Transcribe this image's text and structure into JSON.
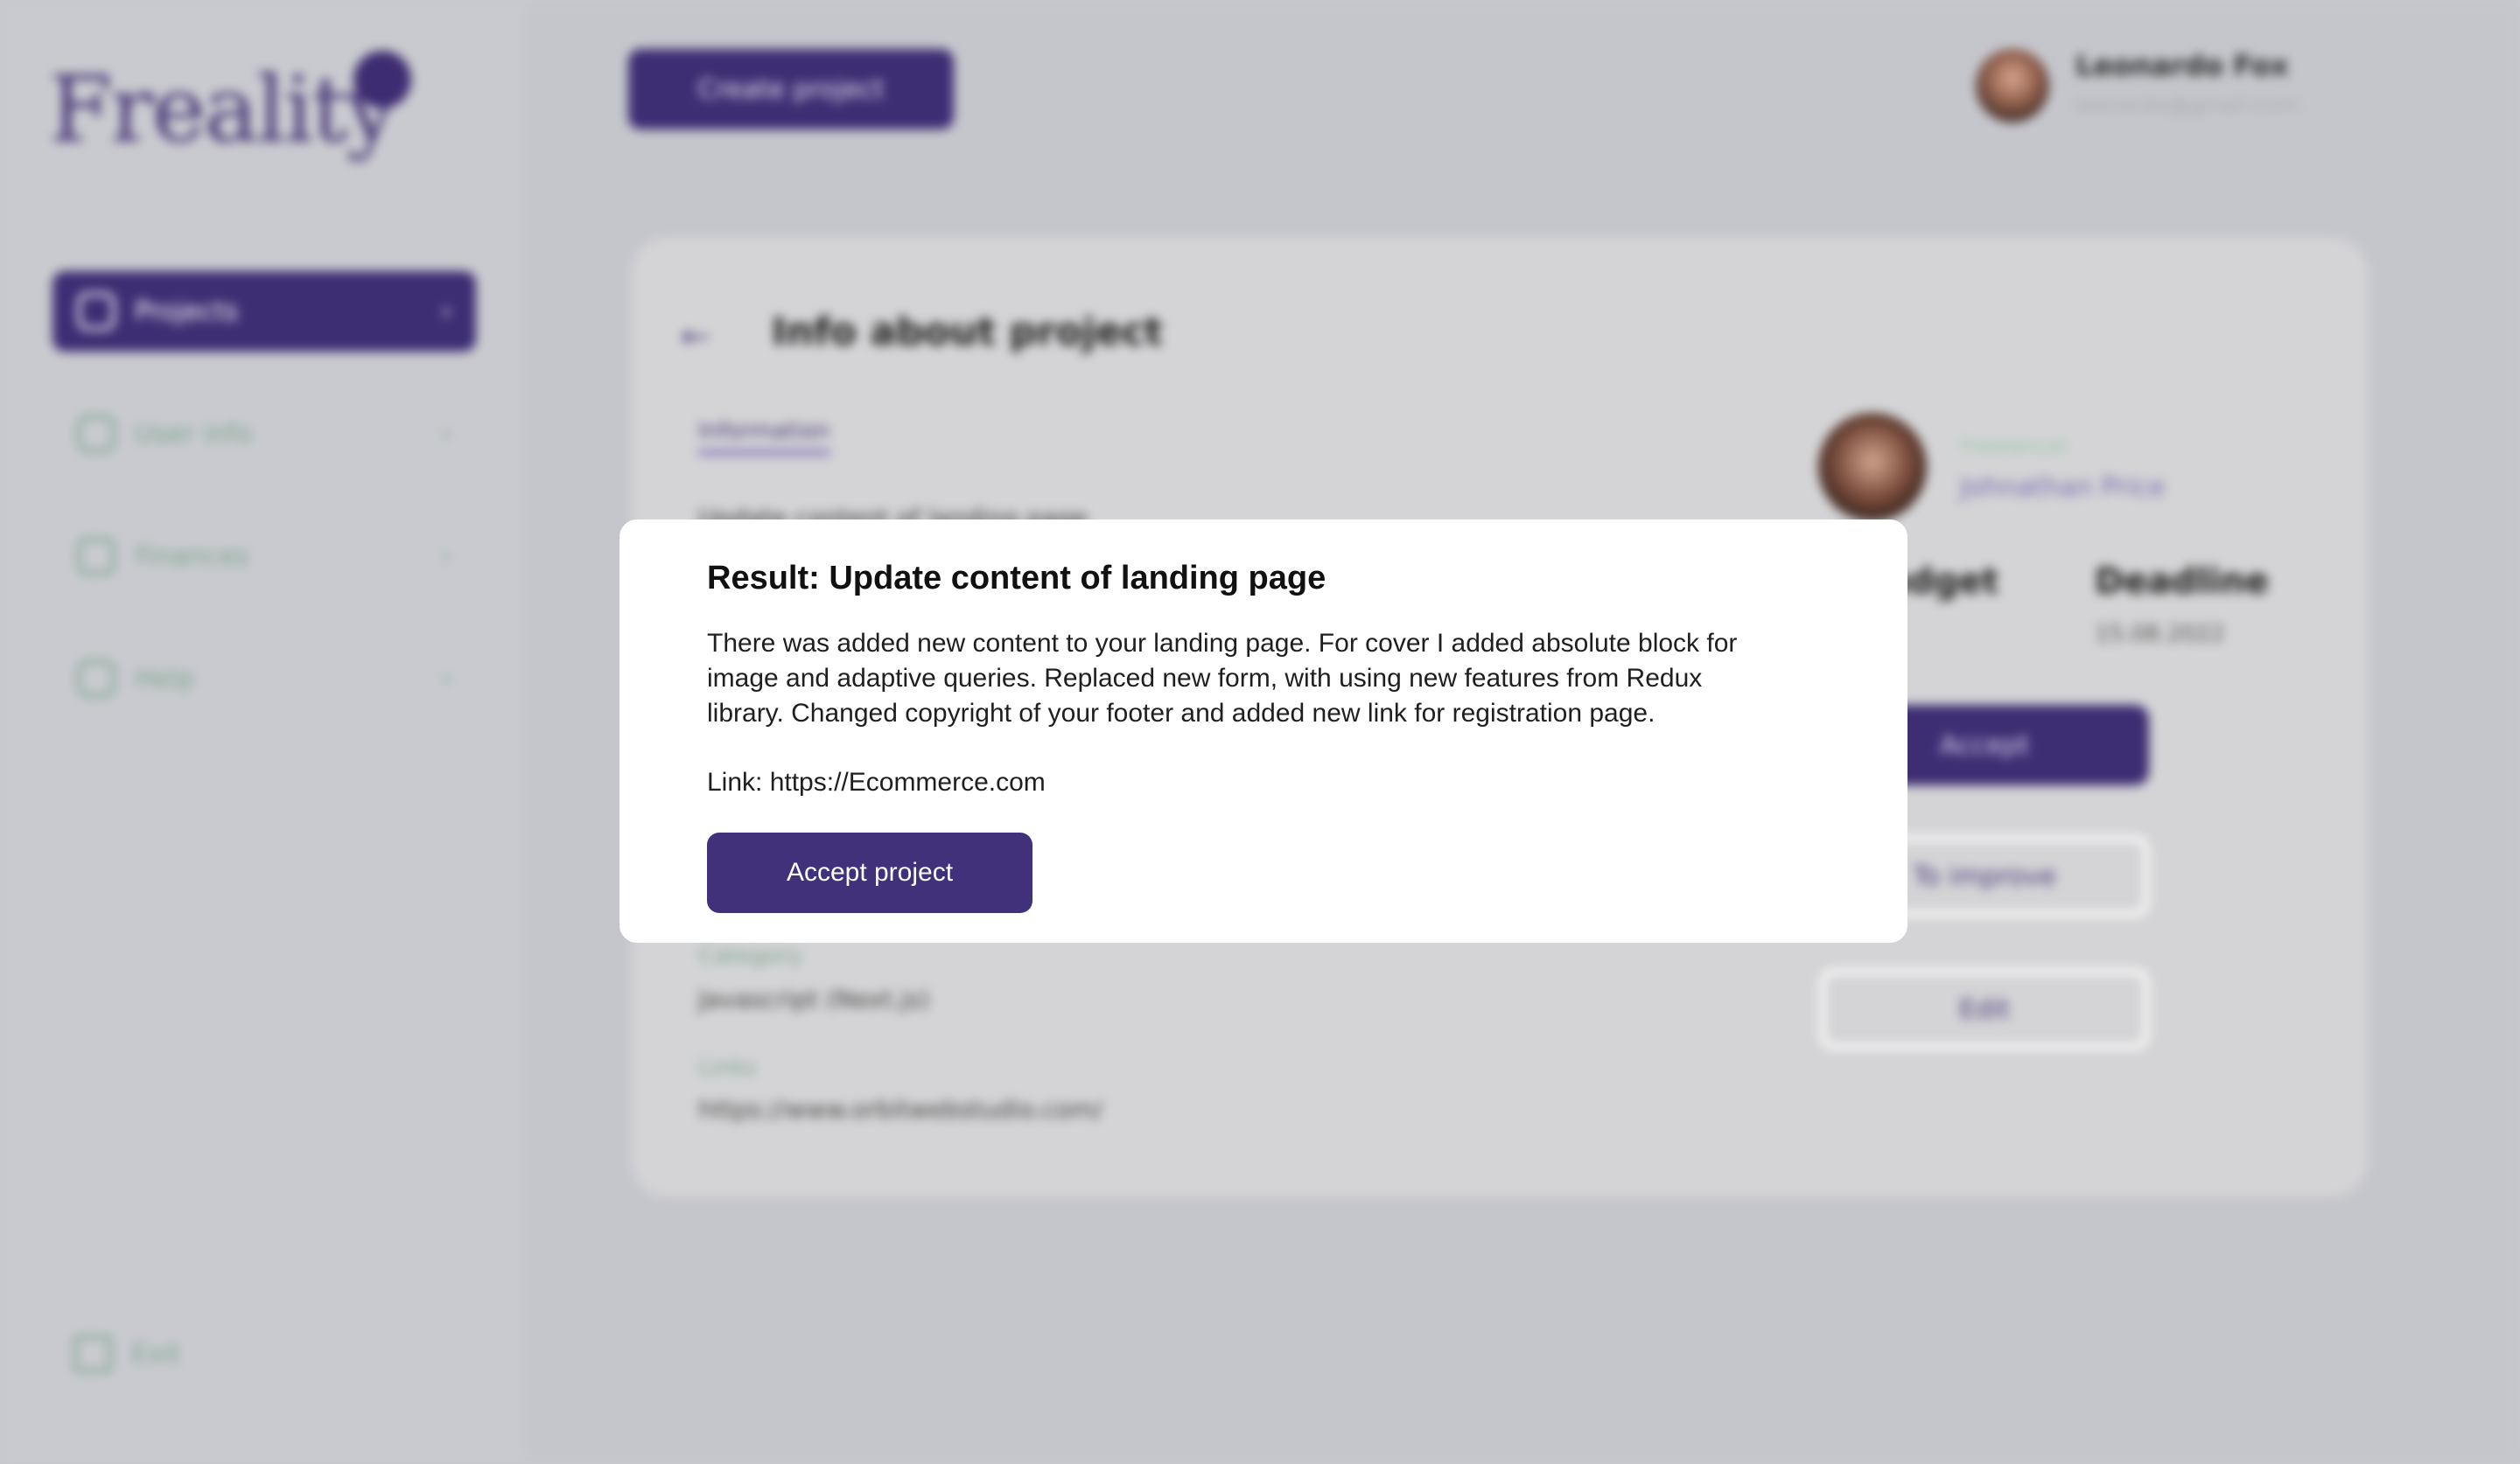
{
  "app": {
    "logo_text": "Freality",
    "create_button": "Create project",
    "user": {
      "name": "Leonardo Fox",
      "email": "leonardo@gmail.com"
    }
  },
  "sidebar": {
    "items": [
      {
        "label": "Projects",
        "active": true
      },
      {
        "label": "User info",
        "active": false
      },
      {
        "label": "Finances",
        "active": false
      },
      {
        "label": "Help",
        "active": false
      }
    ],
    "exit_label": "Exit"
  },
  "project": {
    "title": "Info about project",
    "tab": "Information",
    "line": "Update content of landing page",
    "category_label": "Category",
    "category_value": "Javascript (Next.js)",
    "links_label": "Links",
    "links_value": "https://www.orbitwebstudio.com/",
    "freelancer_label": "Freelancer",
    "freelancer_name": "Johnathan Price",
    "budget_label": "Budget",
    "deadline_label": "Deadline",
    "deadline_value": "15.08.2022",
    "accept_label": "Accept",
    "improve_label": "To improve",
    "edit_label": "Edit"
  },
  "modal": {
    "title": "Result: Update content of landing page",
    "body": "There was added new content to your landing page. For cover I added absolute block for image and adaptive queries. Replaced new form, with using new features from Redux library. Changed copyright of your footer and added new link for registration page.",
    "link": "Link: https://Ecommerce.com",
    "button": "Accept project"
  },
  "colors": {
    "accent": "#41317a",
    "overlay": "#c5c6cc",
    "muted_green": "#7da68f"
  }
}
